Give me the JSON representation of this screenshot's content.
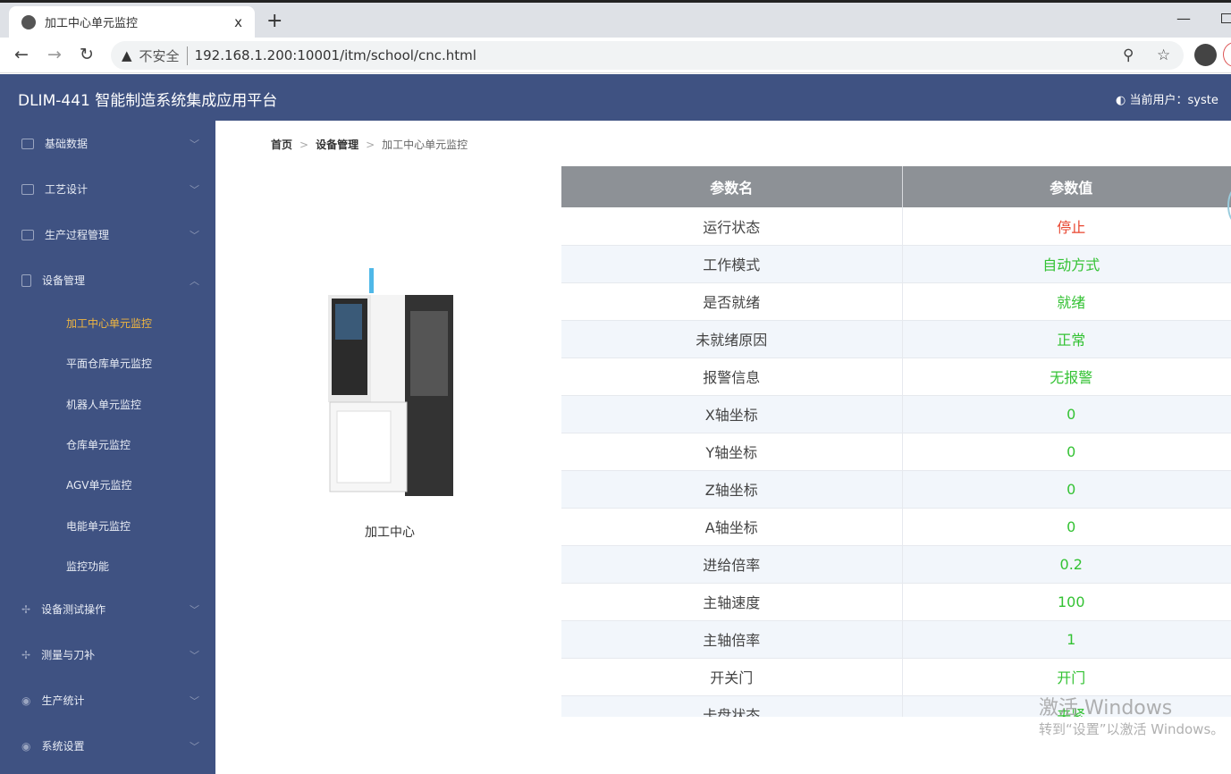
{
  "browser": {
    "tab_title": "加工中心单元监控",
    "close": "x",
    "new_tab": "+",
    "minimize": "—",
    "insecure": "不安全",
    "url": "192.168.1.200:10001/itm/school/cnc.html"
  },
  "header": {
    "title": "DLIM-441 智能制造系统集成应用平台",
    "user": "当前用户：syste"
  },
  "sidebar": {
    "items": [
      {
        "label": "基础数据",
        "chev": "﹀"
      },
      {
        "label": "工艺设计",
        "chev": "﹀"
      },
      {
        "label": "生产过程管理",
        "chev": "﹀"
      },
      {
        "label": "设备管理",
        "chev": "︿"
      }
    ],
    "sub": [
      "加工中心单元监控",
      "平面仓库单元监控",
      "机器人单元监控",
      "仓库单元监控",
      "AGV单元监控",
      "电能单元监控",
      "监控功能"
    ],
    "items2": [
      {
        "label": "设备测试操作",
        "chev": "﹀"
      },
      {
        "label": "测量与刀补",
        "chev": "﹀"
      },
      {
        "label": "生产统计",
        "chev": "﹀"
      },
      {
        "label": "系统设置",
        "chev": "﹀"
      }
    ]
  },
  "breadcrumb": {
    "home": "首页",
    "section": "设备管理",
    "current": "加工中心单元监控",
    "sep": ">"
  },
  "machine": {
    "label": "加工中心"
  },
  "table": {
    "headers": [
      "参数名",
      "参数值"
    ],
    "rows": [
      [
        "运行状态",
        "停止",
        "#e8452f"
      ],
      [
        "工作模式",
        "自动方式",
        "#33c233"
      ],
      [
        "是否就绪",
        "就绪",
        "#33c233"
      ],
      [
        "未就绪原因",
        "正常",
        "#33c233"
      ],
      [
        "报警信息",
        "无报警",
        "#33c233"
      ],
      [
        "X轴坐标",
        "0",
        "#33c233"
      ],
      [
        "Y轴坐标",
        "0",
        "#33c233"
      ],
      [
        "Z轴坐标",
        "0",
        "#33c233"
      ],
      [
        "A轴坐标",
        "0",
        "#33c233"
      ],
      [
        "进给倍率",
        "0.2",
        "#33c233"
      ],
      [
        "主轴速度",
        "100",
        "#33c233"
      ],
      [
        "主轴倍率",
        "1",
        "#33c233"
      ],
      [
        "开关门",
        "开门",
        "#33c233"
      ],
      [
        "卡盘状态",
        "夹紧",
        "#33c233"
      ]
    ]
  },
  "watermark": {
    "line1": "激活 Windows",
    "line2": "转到“设置”以激活 Windows。"
  }
}
